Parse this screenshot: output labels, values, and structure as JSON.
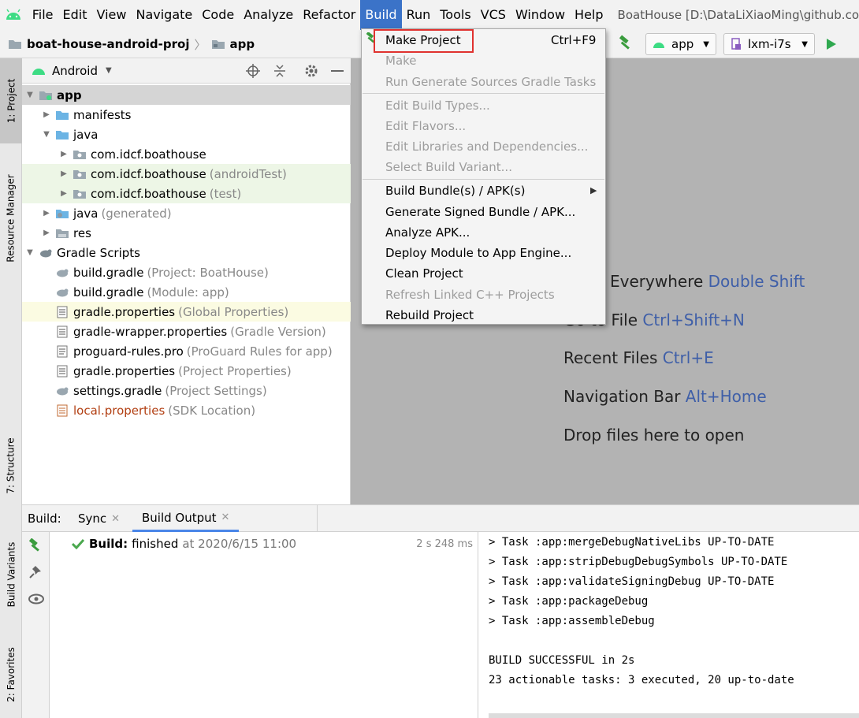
{
  "menubar": {
    "items": [
      "File",
      "Edit",
      "View",
      "Navigate",
      "Code",
      "Analyze",
      "Refactor",
      "Build",
      "Run",
      "Tools",
      "VCS",
      "Window",
      "Help"
    ],
    "window_title": "BoatHouse [D:\\DataLiXiaoMing\\github.co"
  },
  "toolbar": {
    "breadcrumb_project": "boat-house-android-proj",
    "breadcrumb_module": "app",
    "run_config": "app",
    "device": "lxm-i7s"
  },
  "left_stripe": {
    "tabs": [
      "1: Project",
      "Resource Manager",
      "7: Structure",
      "Build Variants",
      "2: Favorites"
    ]
  },
  "project_panel": {
    "view_selector": "Android",
    "tree": [
      {
        "label": "app",
        "hint": ""
      },
      {
        "label": "manifests",
        "hint": ""
      },
      {
        "label": "java",
        "hint": ""
      },
      {
        "label": "com.idcf.boathouse",
        "hint": ""
      },
      {
        "label": "com.idcf.boathouse",
        "hint": "(androidTest)"
      },
      {
        "label": "com.idcf.boathouse",
        "hint": "(test)"
      },
      {
        "label": "java",
        "hint": "(generated)"
      },
      {
        "label": "res",
        "hint": ""
      },
      {
        "label": "Gradle Scripts",
        "hint": ""
      },
      {
        "label": "build.gradle",
        "hint": "(Project: BoatHouse)"
      },
      {
        "label": "build.gradle",
        "hint": "(Module: app)"
      },
      {
        "label": "gradle.properties",
        "hint": "(Global Properties)"
      },
      {
        "label": "gradle-wrapper.properties",
        "hint": "(Gradle Version)"
      },
      {
        "label": "proguard-rules.pro",
        "hint": "(ProGuard Rules for app)"
      },
      {
        "label": "gradle.properties",
        "hint": "(Project Properties)"
      },
      {
        "label": "settings.gradle",
        "hint": "(Project Settings)"
      },
      {
        "label": "local.properties",
        "hint": "(SDK Location)"
      }
    ]
  },
  "build_menu": {
    "make_project": "Make Project",
    "make_project_shortcut": "Ctrl+F9",
    "make": "Make",
    "run_generate": "Run Generate Sources Gradle Tasks",
    "edit_build_types": "Edit Build Types...",
    "edit_flavors": "Edit Flavors...",
    "edit_libraries": "Edit Libraries and Dependencies...",
    "select_build_variant": "Select Build Variant...",
    "build_bundle": "Build Bundle(s) / APK(s)",
    "generate_signed": "Generate Signed Bundle / APK...",
    "analyze_apk": "Analyze APK...",
    "deploy_module": "Deploy Module to App Engine...",
    "clean_project": "Clean Project",
    "refresh_linked": "Refresh Linked C++ Projects",
    "rebuild_project": "Rebuild Project"
  },
  "editor_tips": {
    "search_everywhere": "h Everywhere",
    "search_everywhere_key": "Double Shift",
    "go_to_file": "Go to File",
    "go_to_file_key": "Ctrl+Shift+N",
    "recent_files": "Recent Files",
    "recent_files_key": "Ctrl+E",
    "navigation_bar": "Navigation Bar",
    "navigation_bar_key": "Alt+Home",
    "drop_files": "Drop files here to open"
  },
  "build_panel": {
    "label": "Build:",
    "tab_sync": "Sync",
    "tab_output": "Build Output",
    "status_bold": "Build:",
    "status_text": "finished",
    "status_time": "at 2020/6/15 11:00",
    "duration": "2 s 248 ms",
    "console": [
      "> Task :app:mergeDebugNativeLibs UP-TO-DATE",
      "> Task :app:stripDebugDebugSymbols UP-TO-DATE",
      "> Task :app:validateSigningDebug UP-TO-DATE",
      "> Task :app:packageDebug",
      "> Task :app:assembleDebug",
      "",
      "BUILD SUCCESSFUL in 2s",
      "23 actionable tasks: 3 executed, 20 up-to-date"
    ]
  },
  "colors": {
    "accent": "#3b73c8",
    "highlight_box": "#e0322f",
    "android_green": "#3ddc84",
    "link_blue": "#3f5fa8",
    "run_green": "#2fa84f"
  }
}
